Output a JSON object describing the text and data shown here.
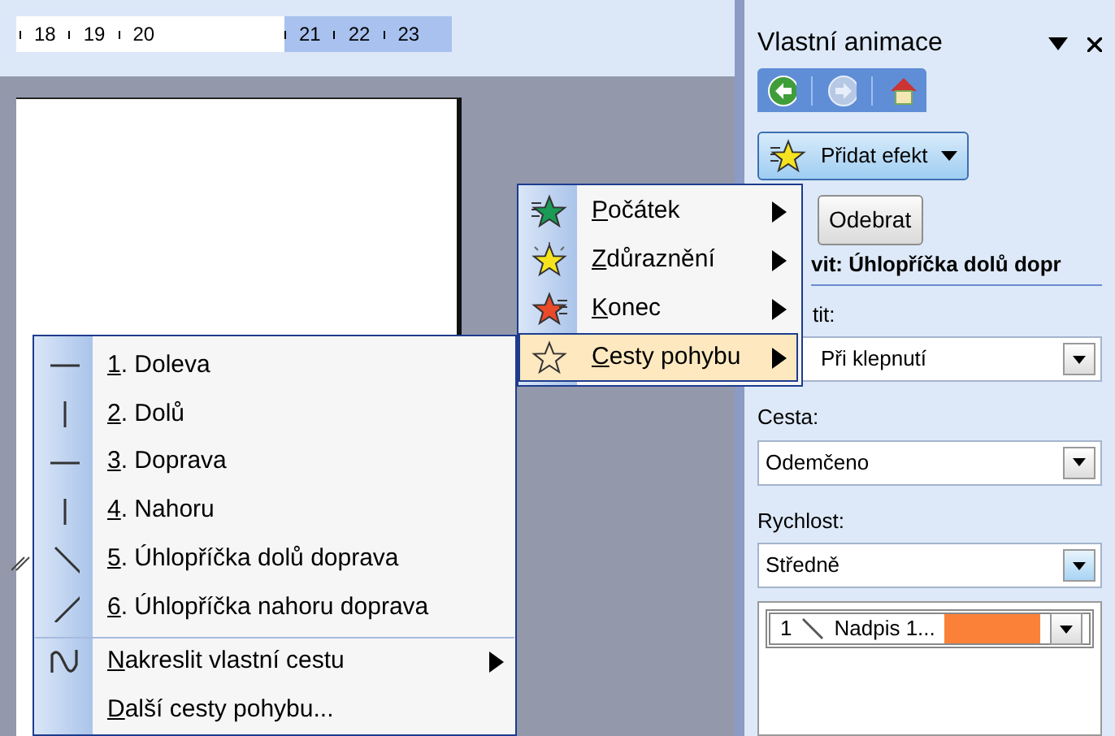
{
  "ruler": {
    "labels": [
      "18",
      "19",
      "20",
      "21",
      "22",
      "23"
    ]
  },
  "task_pane": {
    "title": "Vlastní animace",
    "add_effect_button": "Přidat efekt",
    "remove_button": "Odebrat",
    "modify_heading": "vit: Úhlopříčka dolů dopr",
    "start": {
      "label": "tit:",
      "value": "Při klepnutí"
    },
    "path": {
      "label": "Cesta:",
      "value": "Odemčeno"
    },
    "speed": {
      "label": "Rychlost:",
      "value": "Středně"
    },
    "animation_list": [
      {
        "number": "1",
        "name": "Nadpis 1...",
        "selected": true
      }
    ]
  },
  "effect_menu": [
    {
      "key": "P",
      "label": "očátek",
      "selected": false
    },
    {
      "key": "Z",
      "label": "důraznění",
      "selected": false
    },
    {
      "key": "K",
      "label": "onec",
      "selected": false
    },
    {
      "key": "C",
      "label": "esty pohybu",
      "selected": true
    }
  ],
  "motion_menu": [
    {
      "key": "1",
      "label": ". Doleva",
      "submenu": false,
      "separator_before": false
    },
    {
      "key": "2",
      "label": ". Dolů",
      "submenu": false,
      "separator_before": false
    },
    {
      "key": "3",
      "label": ". Doprava",
      "submenu": false,
      "separator_before": false
    },
    {
      "key": "4",
      "label": ". Nahoru",
      "submenu": false,
      "separator_before": false
    },
    {
      "key": "5",
      "label": ". Úhlopříčka dolů doprava",
      "submenu": false,
      "separator_before": false
    },
    {
      "key": "6",
      "label": ". Úhlopříčka nahoru doprava",
      "submenu": false,
      "separator_before": false
    },
    {
      "key": "N",
      "label": "akreslit vlastní cestu",
      "submenu": true,
      "separator_before": true
    },
    {
      "key": "D",
      "label": "alší cesty pohybu...",
      "submenu": false,
      "separator_before": false
    }
  ]
}
